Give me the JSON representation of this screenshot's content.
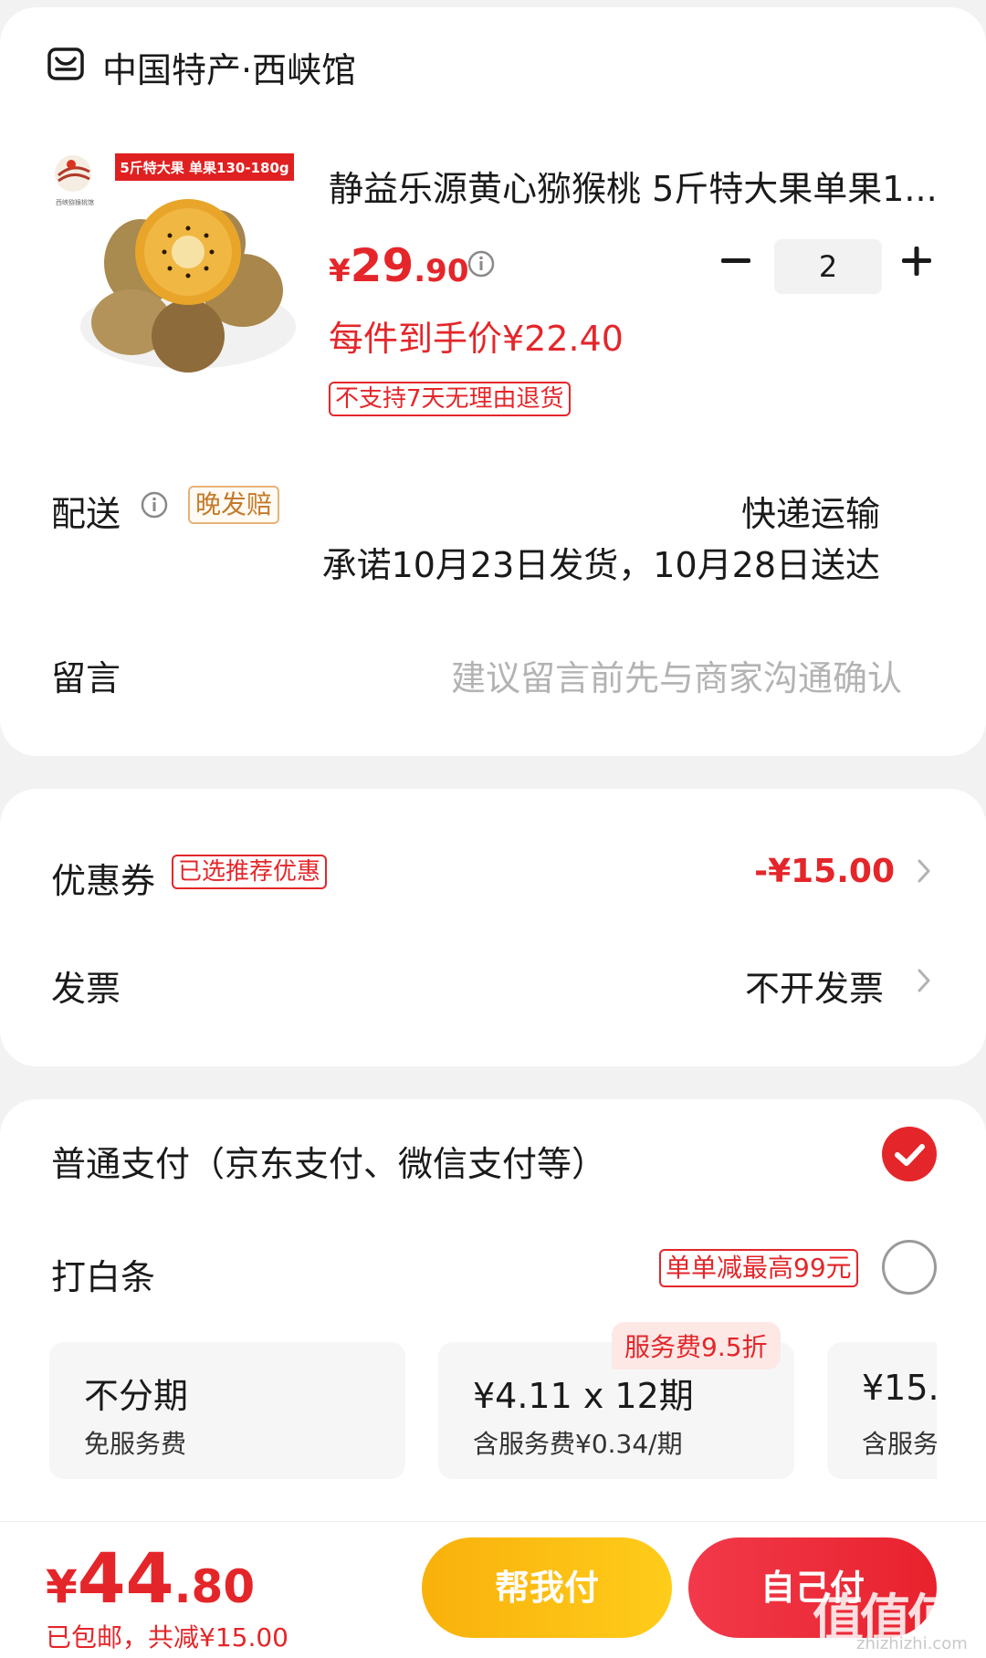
{
  "store": {
    "name": "中国特产·西峡馆",
    "icon": "store-icon"
  },
  "product": {
    "banner_text": "5斤特大果 单果130-180g",
    "brand_logo_text": "西峡猕猴桃馆",
    "title": "静益乐源黄心猕猴桃 5斤特大果单果1...",
    "price_currency": "¥",
    "price_int": "29",
    "price_dec": ".90",
    "per_item_price": "每件到手价¥22.40",
    "return_tag": "不支持7天无理由退货",
    "quantity": "2"
  },
  "delivery": {
    "label": "配送",
    "tag": "晚发赔",
    "method": "快递运输",
    "promise": "承诺10月23日发货，10月28日送达"
  },
  "message": {
    "label": "留言",
    "placeholder": "建议留言前先与商家沟通确认"
  },
  "coupon": {
    "label": "优惠券",
    "tag": "已选推荐优惠",
    "value": "-¥15.00"
  },
  "invoice": {
    "label": "发票",
    "value": "不开发票"
  },
  "payment": {
    "normal_label": "普通支付（京东支付、微信支付等）",
    "normal_selected": true,
    "baitiao_label": "打白条",
    "baitiao_promo": "单单减最高99元",
    "baitiao_selected": false,
    "service_discount": "服务费9.5折",
    "plans": [
      {
        "title": "不分期",
        "sub": "免服务费"
      },
      {
        "title": "¥4.11 x 12期",
        "sub": "含服务费¥0.34/期"
      },
      {
        "title": "¥15.",
        "sub": "含服务"
      }
    ]
  },
  "footer": {
    "total_currency": "¥",
    "total_int": "44",
    "total_dec": ".80",
    "summary": "已包邮，共减¥15.00",
    "help_pay_label": "帮我付",
    "self_pay_label": "自己付"
  },
  "watermark": {
    "text": "值值值",
    "sub": "zhizhizhi.com"
  },
  "colors": {
    "accent": "#e4262a",
    "help_pay": "#fbbf12",
    "self_pay": "#ec2c38"
  }
}
